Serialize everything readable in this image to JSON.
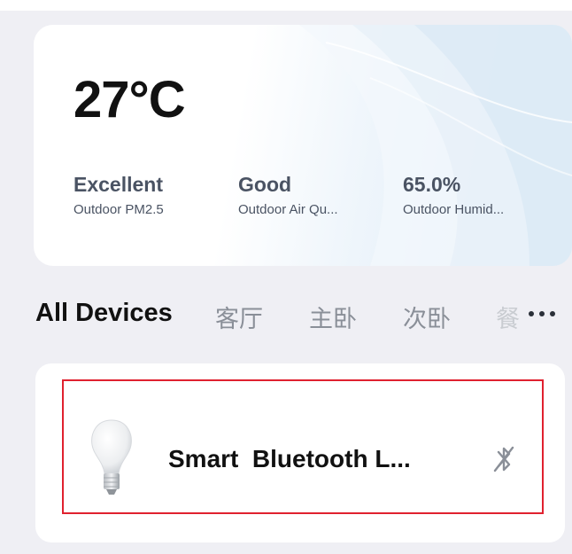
{
  "weather": {
    "temperature": "27°C",
    "stats": [
      {
        "value": "Excellent",
        "label": "Outdoor PM2.5"
      },
      {
        "value": "Good",
        "label": "Outdoor Air Qu..."
      },
      {
        "value": "65.0%",
        "label": "Outdoor Humid..."
      }
    ]
  },
  "tabs": {
    "items": [
      "All Devices",
      "客厅",
      "主卧",
      "次卧",
      "餐"
    ],
    "active": "All Devices",
    "more_icon": "more-horizontal-icon"
  },
  "device": {
    "name": "Smart  Bluetooth L...",
    "image_icon": "light-bulb-icon",
    "status_icon": "bluetooth-disconnected-icon",
    "highlight_color": "#e0212f"
  }
}
